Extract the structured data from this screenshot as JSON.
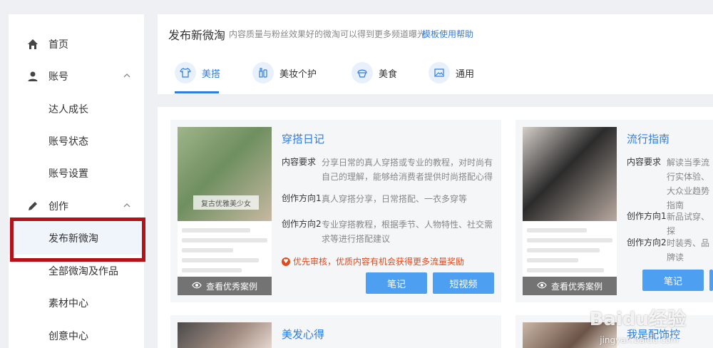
{
  "sidebar": {
    "items": [
      {
        "label": "首页"
      },
      {
        "label": "账号"
      },
      {
        "label": "达人成长"
      },
      {
        "label": "账号状态"
      },
      {
        "label": "账号设置"
      },
      {
        "label": "创作"
      },
      {
        "label": "发布新微淘"
      },
      {
        "label": "全部微淘及作品"
      },
      {
        "label": "素材中心"
      },
      {
        "label": "创意中心"
      }
    ]
  },
  "header": {
    "title": "发布新微淘",
    "desc": "内容质量与粉丝效果好的微淘可以得到更多频道曝光",
    "help": "模板使用帮助",
    "tabs": [
      {
        "label": "美搭"
      },
      {
        "label": "美妆个护"
      },
      {
        "label": "美食"
      },
      {
        "label": "通用"
      }
    ]
  },
  "cards": [
    {
      "title": "穿搭日记",
      "thumb_caption": "复古优雅美少女",
      "view_case": "查看优秀案例",
      "req_label": "内容要求",
      "req_text": "分享日常的真人穿搭或专业的教程，对时尚有自己的理解，能够给消费者提供时尚搭配心得",
      "dir1_label": "创作方向1",
      "dir1_text": "真人穿搭分享，日常搭配、一衣多穿等",
      "dir2_label": "创作方向2",
      "dir2_text": "专业穿搭教程，根据季节、人物特性、社交需求等进行搭配建议",
      "promo": "优先审核，优质内容有机会获得更多流量奖励",
      "btn_note": "笔记",
      "btn_video": "短视频"
    },
    {
      "title": "流行指南",
      "thumb_caption": "",
      "view_case": "查看优秀案例",
      "req_label": "内容要求",
      "req_text": "解读当季流行实体验、大众业趋势指南",
      "dir1_label": "创作方向1",
      "dir1_text": "新品试穿、探",
      "dir2_label": "创作方向2",
      "dir2_text": "时装秀、品牌读",
      "btn_note": "笔记"
    },
    {
      "title": "美发心得"
    },
    {
      "title": "我是配饰控"
    }
  ],
  "watermark": {
    "text": "Baidu经验",
    "sub": "jingyan.baidu.com"
  }
}
